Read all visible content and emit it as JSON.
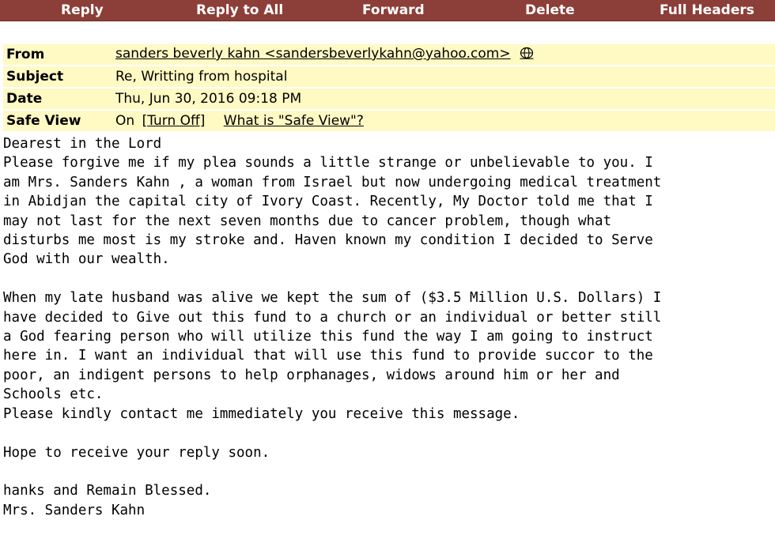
{
  "toolbar": {
    "reply": "Reply",
    "reply_all": "Reply to All",
    "forward": "Forward",
    "delete": "Delete",
    "full_headers": "Full Headers",
    "background_color": "#8c3e38"
  },
  "headers": {
    "from_label": "From",
    "from_value": "sanders beverly kahn <sandersbeverlykahn@yahoo.com>",
    "from_icon": "globe-icon",
    "subject_label": "Subject",
    "subject_value": "Re, Writting from hospital",
    "date_label": "Date",
    "date_value": "Thu, Jun 30, 2016 09:18 PM",
    "safe_view_label": "Safe View",
    "safe_view_state": "On",
    "turn_off_link": "[Turn Off]",
    "what_is_link": "What is \"Safe View\"?",
    "background_color": "#fff9c4"
  },
  "message": {
    "body": "Dearest in the Lord\nPlease forgive me if my plea sounds a little strange or unbelievable to you. I\nam Mrs. Sanders Kahn , a woman from Israel but now undergoing medical treatment\nin Abidjan the capital city of Ivory Coast. Recently, My Doctor told me that I\nmay not last for the next seven months due to cancer problem, though what\ndisturbs me most is my stroke and. Haven known my condition I decided to Serve\nGod with our wealth.\n\nWhen my late husband was alive we kept the sum of ($3.5 Million U.S. Dollars) I\nhave decided to Give out this fund to a church or an individual or better still\na God fearing person who will utilize this fund the way I am going to instruct\nhere in. I want an individual that will use this fund to provide succor to the\npoor, an indigent persons to help orphanages, widows around him or her and\nSchools etc.\nPlease kindly contact me immediately you receive this message.\n\nHope to receive your reply soon.\n\nhanks and Remain Blessed.\nMrs. Sanders Kahn"
  }
}
